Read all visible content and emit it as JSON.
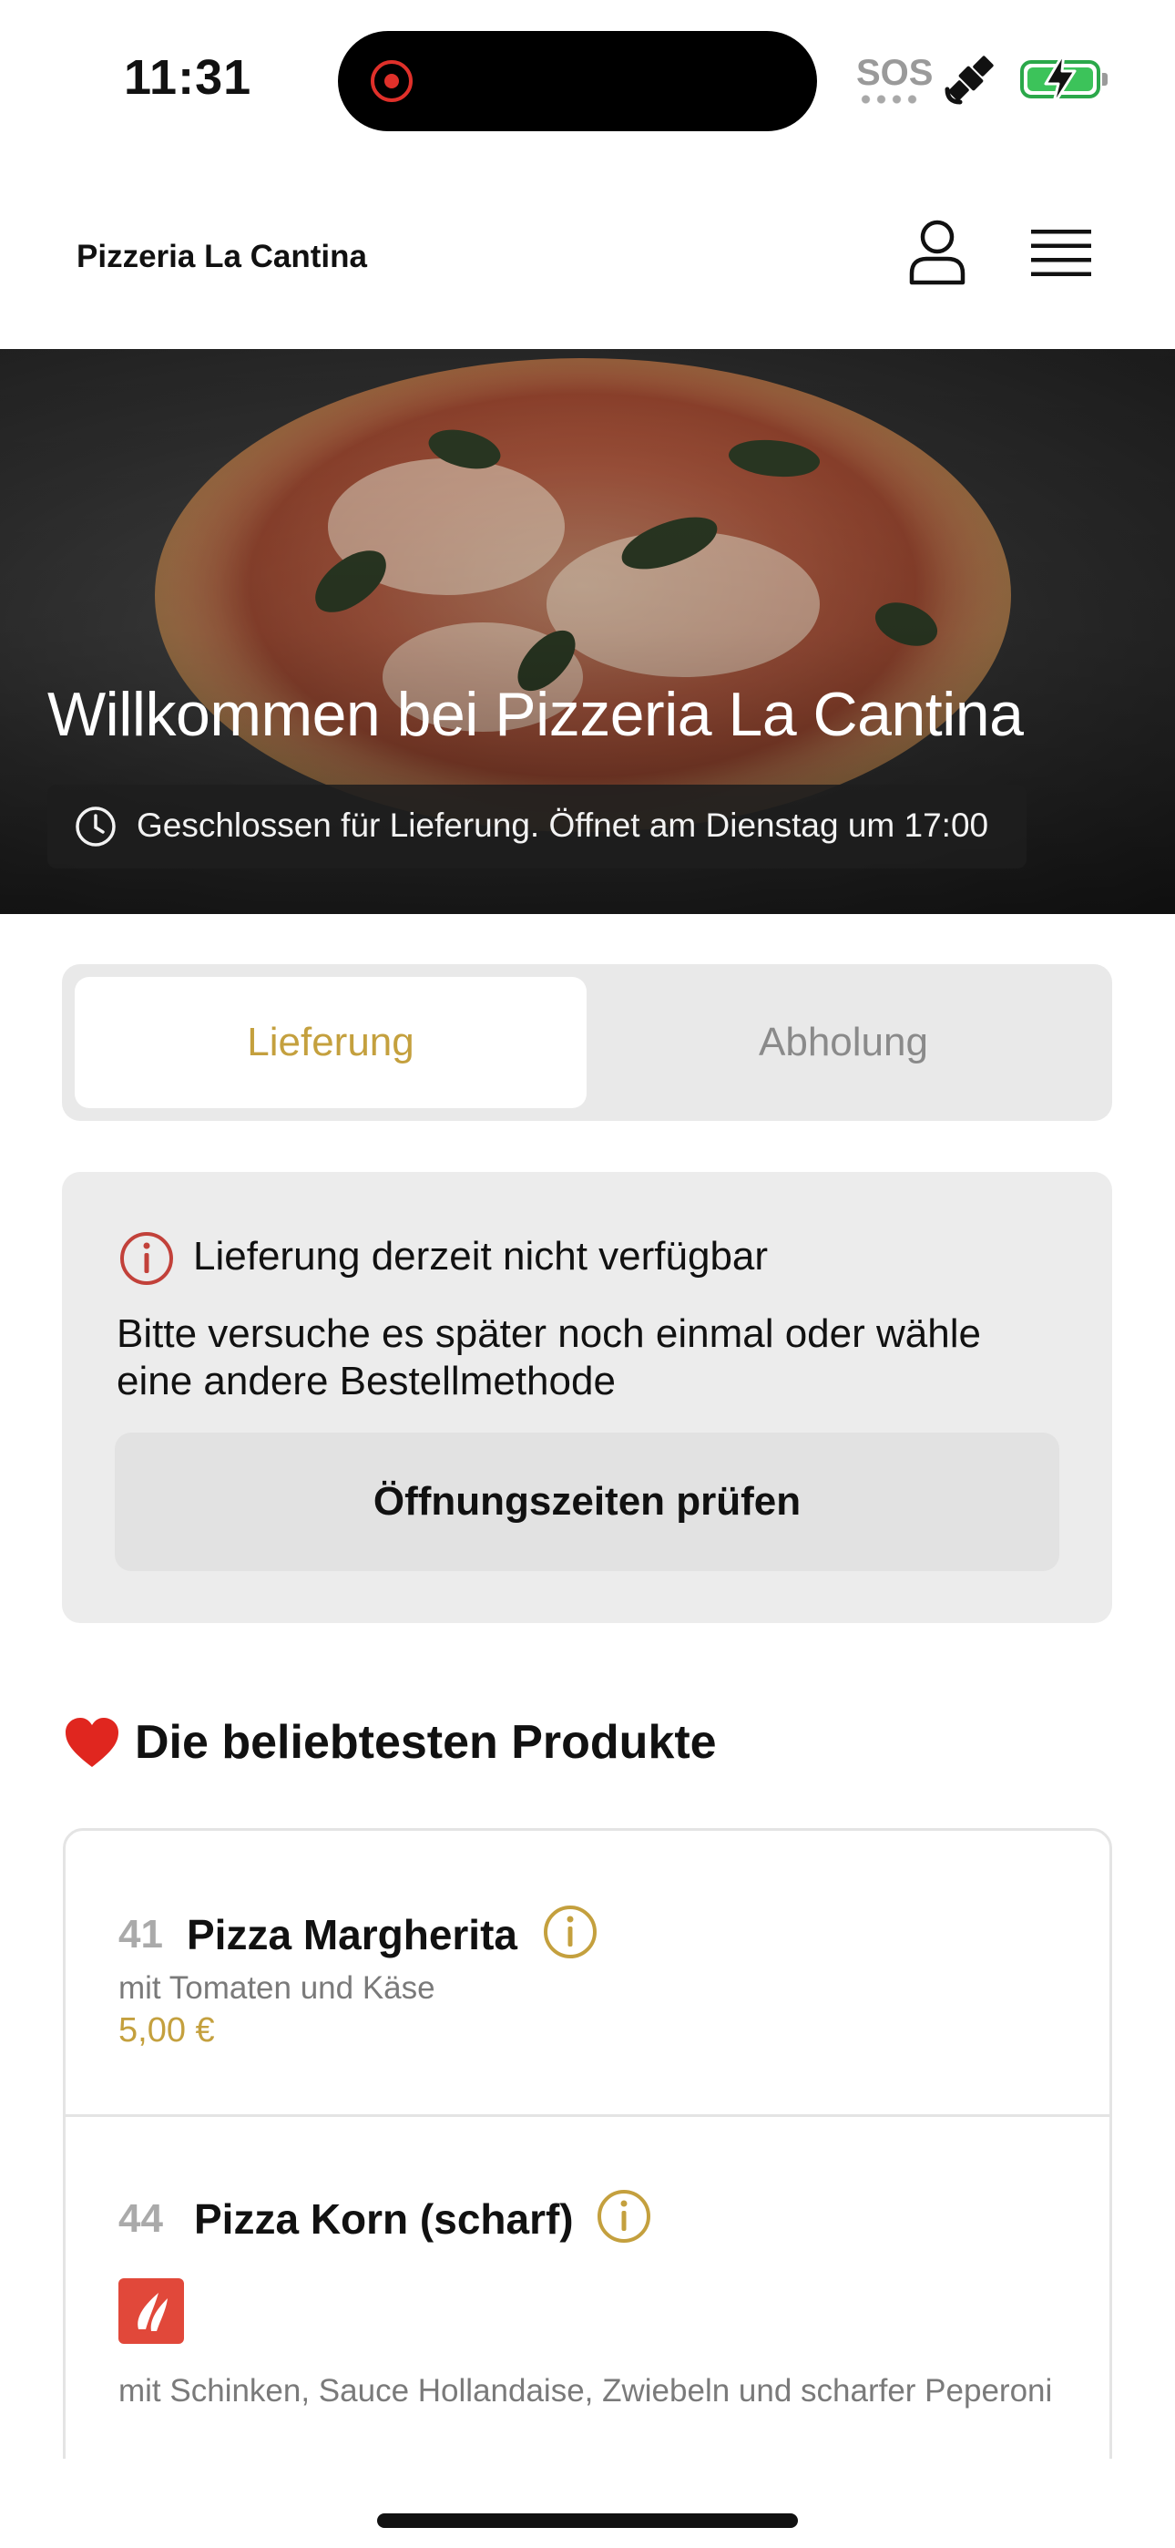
{
  "status_bar": {
    "time": "11:31",
    "sos": "SOS",
    "icons": [
      "recording-indicator-icon",
      "satellite-icon",
      "battery-charging-icon"
    ]
  },
  "header": {
    "brand": "Pizzeria La Cantina",
    "icons": [
      "user-icon",
      "hamburger-menu-icon"
    ]
  },
  "hero": {
    "title": "Willkommen bei Pizzeria La Cantina",
    "status": "Geschlossen für Lieferung. Öffnet am Dienstag um 17:00"
  },
  "tabs": {
    "delivery": "Lieferung",
    "pickup": "Abholung",
    "active": "delivery"
  },
  "notice": {
    "title": "Lieferung derzeit nicht verfügbar",
    "text": "Bitte versuche es später noch einmal oder wähle eine andere Bestellmethode",
    "button": "Öffnungszeiten prüfen"
  },
  "products": {
    "section_title": "Die beliebtesten Produkte",
    "items": [
      {
        "number": "41",
        "name": "Pizza Margherita",
        "description": "mit Tomaten und Käse",
        "price": "5,00 €"
      },
      {
        "number": "44",
        "name": "Pizza Korn (scharf)",
        "description": "mit Schinken, Sauce Hollandaise, Zwiebeln und scharfer Peperoni",
        "badge": "spicy-icon"
      }
    ]
  },
  "colors": {
    "accent": "#c4a03e",
    "alert": "#c2413a",
    "spicy": "#e1483a",
    "battery": "#3cc35a"
  }
}
